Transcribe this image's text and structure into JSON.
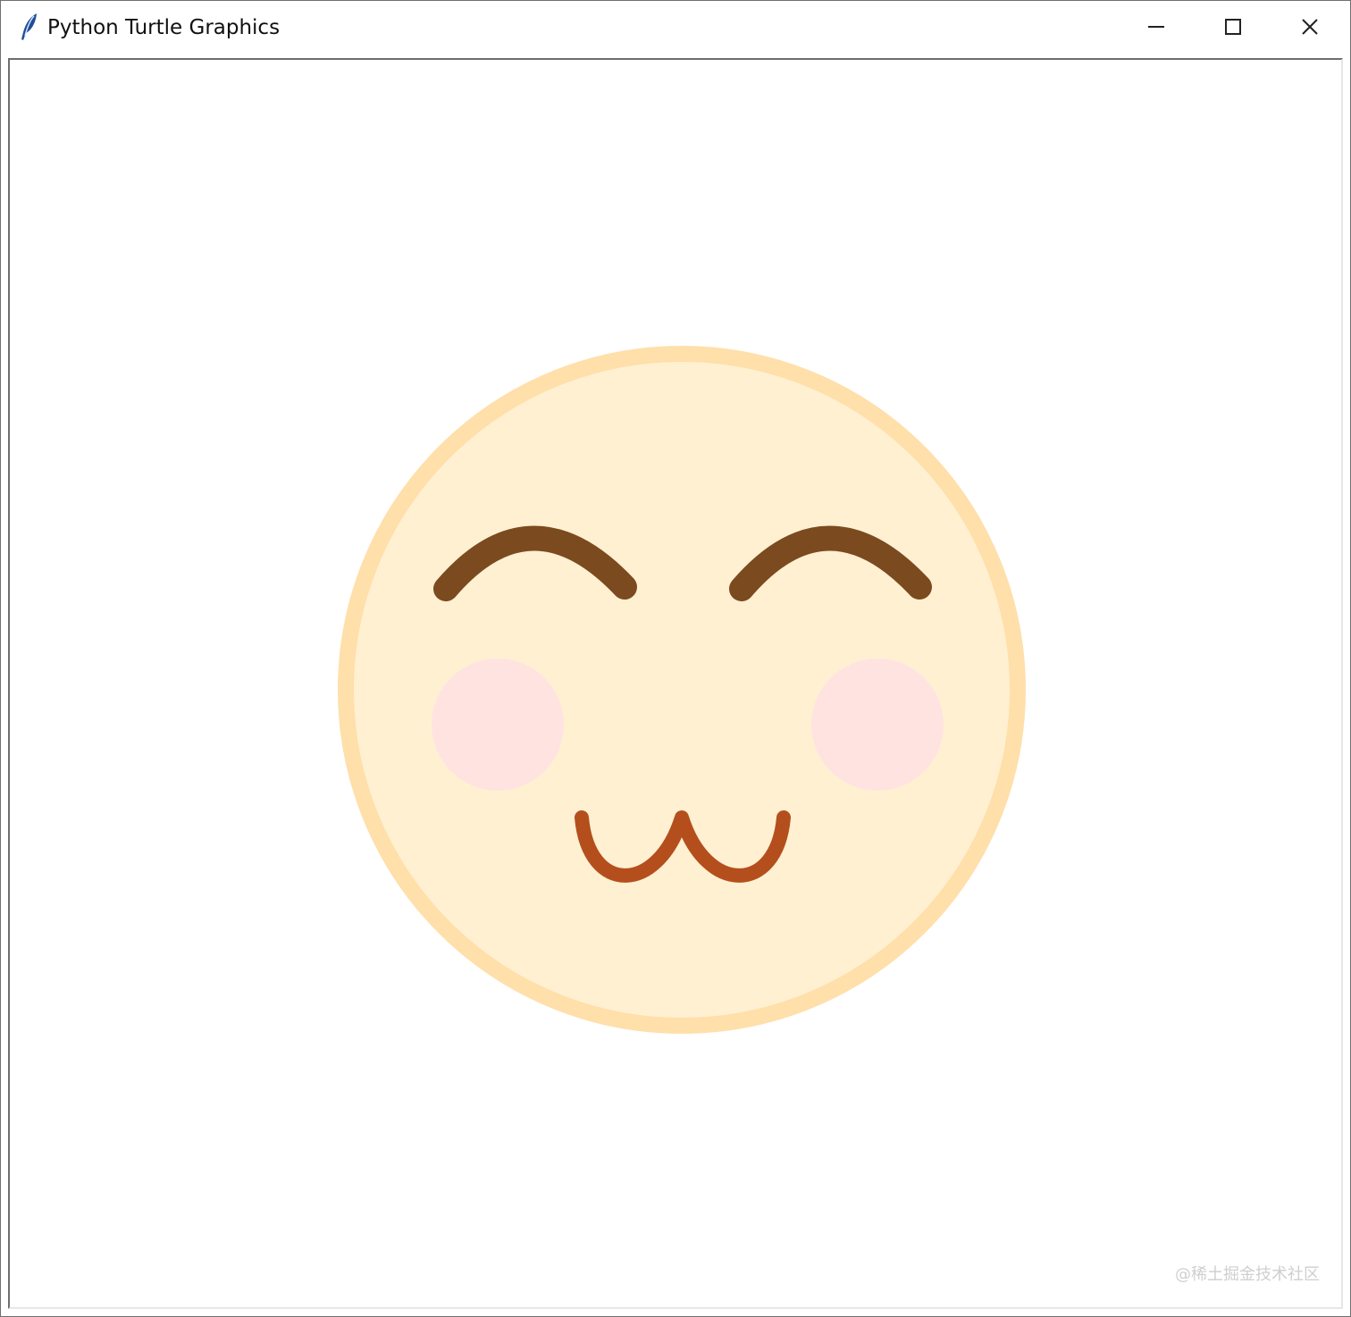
{
  "window": {
    "title": "Python Turtle Graphics",
    "icon": "feather-icon",
    "controls": [
      "minimize-icon",
      "maximize-icon",
      "close-icon"
    ]
  },
  "canvas": {
    "background": "#ffffff",
    "watermark": "@稀土掘金技术社区"
  },
  "drawing": {
    "face_fill": "#fff0d2",
    "face_outline": "#ffdfaa",
    "eyebrow_color": "#7b4a1f",
    "blush_color": "#ffe3e1",
    "mouth_color": "#b44f1d"
  }
}
